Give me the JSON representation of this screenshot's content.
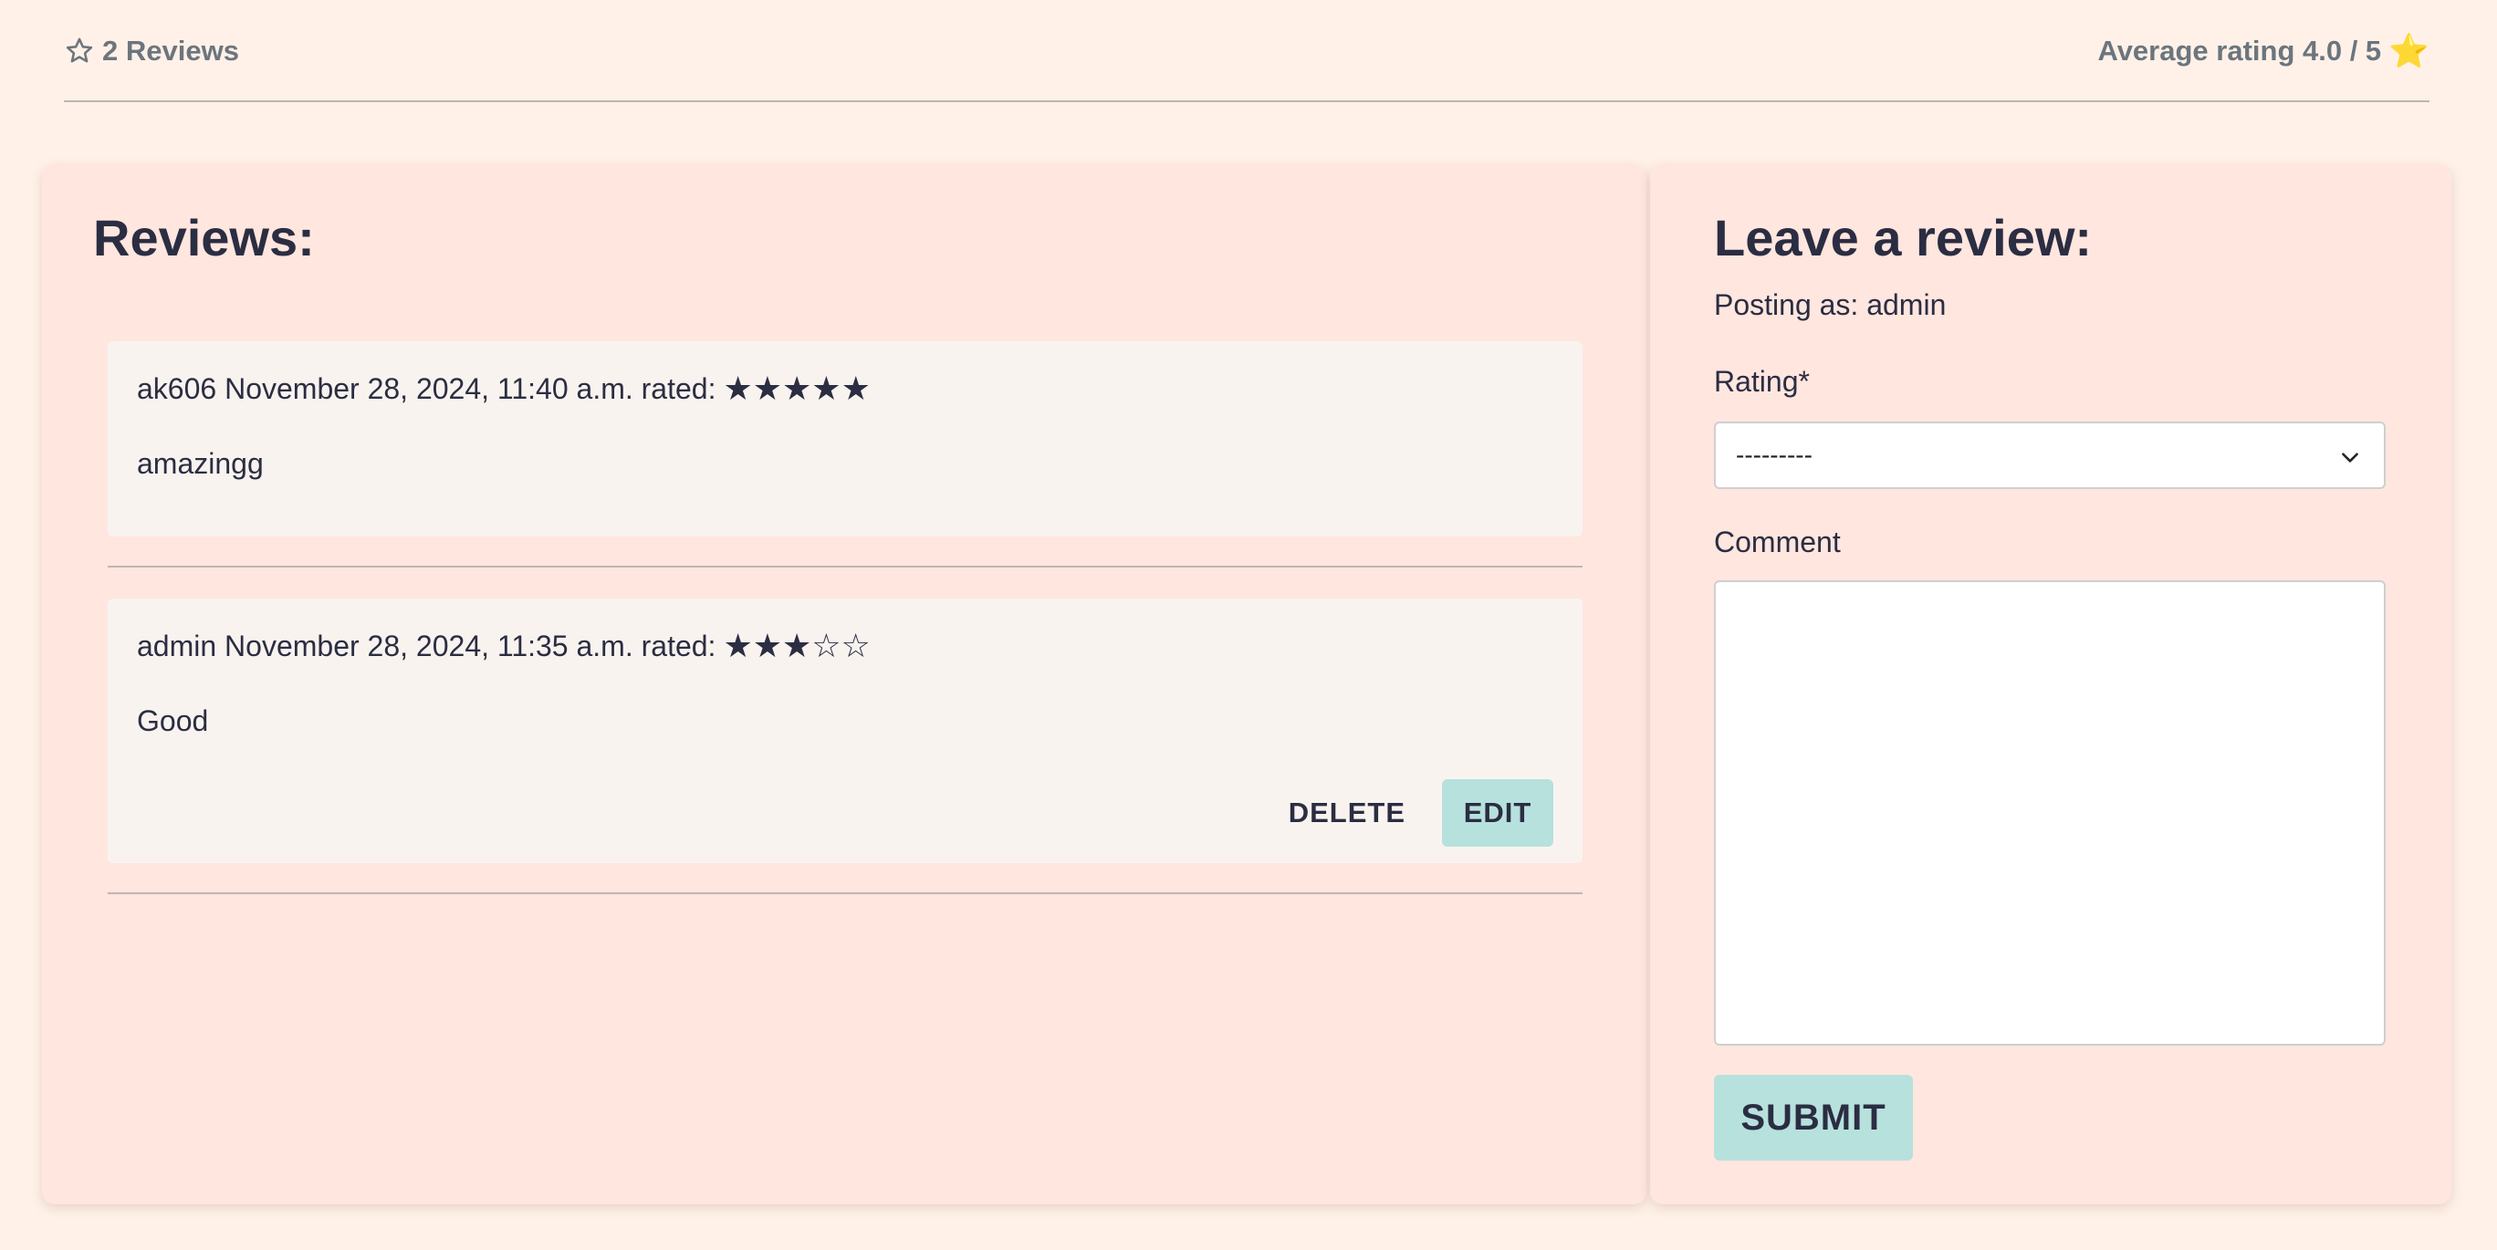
{
  "header": {
    "reviews_count_label": "2 Reviews",
    "reviews_icon": "star-outline-icon",
    "average_label": "Average rating 4.0 / 5",
    "average_icon": "⭐",
    "average_value": 4.0,
    "average_max": 5
  },
  "reviews_section": {
    "title": "Reviews:",
    "items": [
      {
        "meta": "ak606 November 28, 2024, 11:40 a.m. rated:",
        "stars": "★★★★★",
        "rating": 5,
        "comment": "amazingg"
      },
      {
        "meta": "admin November 28, 2024, 11:35 a.m. rated:",
        "stars": "★★★☆☆",
        "rating": 3,
        "comment": "Good",
        "actions": {
          "delete_label": "DELETE",
          "edit_label": "EDIT"
        }
      }
    ]
  },
  "review_form": {
    "title": "Leave a review:",
    "posting_as": "Posting as: admin",
    "rating_label": "Rating*",
    "rating_selected": "---------",
    "comment_label": "Comment",
    "comment_value": "",
    "submit_label": "SUBMIT"
  },
  "colors": {
    "page_bg": "#fff1e8",
    "panel_bg": "#ffe6df",
    "card_bg": "#f9f3ef",
    "button_accent": "#b7e1dd",
    "text_primary": "#2b2d42",
    "text_muted": "#6c757d",
    "star_yellow": "#f5c518"
  }
}
